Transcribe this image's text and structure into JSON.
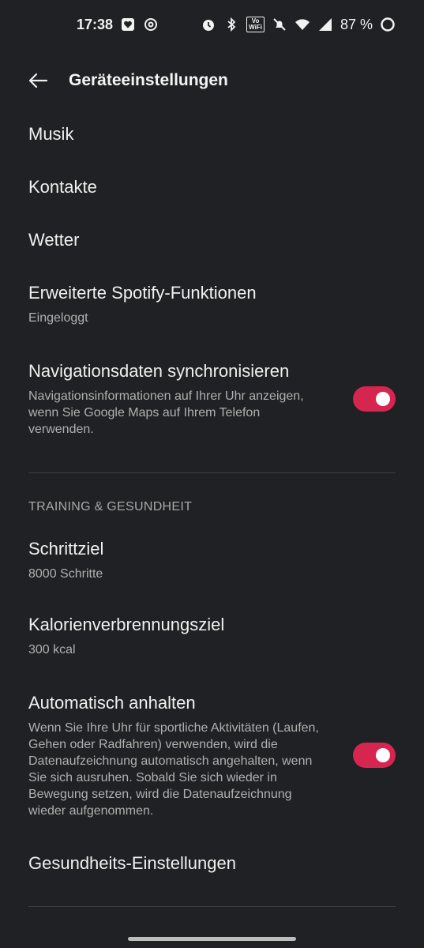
{
  "status_bar": {
    "time": "17:38",
    "battery": "87 %",
    "icons": [
      "heart-box-icon",
      "threads-icon",
      "alarm-icon",
      "bluetooth-icon",
      "vowifi-icon",
      "mute-icon",
      "wifi-icon",
      "signal-icon",
      "battery-ring-icon"
    ],
    "volte_line1": "Vo",
    "volte_line2": "WiFi"
  },
  "app_bar": {
    "title": "Geräteeinstellungen",
    "back_icon": "arrow-left-icon"
  },
  "settings": {
    "musik": {
      "title": "Musik"
    },
    "kontakte": {
      "title": "Kontakte"
    },
    "wetter": {
      "title": "Wetter"
    },
    "spotify": {
      "title": "Erweiterte Spotify-Funktionen",
      "subtitle": "Eingeloggt"
    },
    "navigation": {
      "title": "Navigationsdaten synchronisieren",
      "subtitle": "Navigationsinformationen auf Ihrer Uhr anzeigen, wenn Sie Google Maps auf Ihrem Telefon verwenden.",
      "enabled": true
    }
  },
  "section_training": {
    "header": "TRAINING & GESUNDHEIT",
    "schrittziel": {
      "title": "Schrittziel",
      "subtitle": "8000 Schritte"
    },
    "kalorien": {
      "title": "Kalorienverbrennungsziel",
      "subtitle": "300 kcal"
    },
    "auto_pause": {
      "title": "Automatisch anhalten",
      "subtitle": "Wenn Sie Ihre Uhr für sportliche Aktivitäten (Laufen, Gehen oder Radfahren) verwenden, wird die Datenaufzeichnung automatisch angehalten, wenn Sie sich ausruhen. Sobald Sie sich wieder in Bewegung setzen, wird die Datenaufzeichnung wieder aufgenommen.",
      "enabled": true
    },
    "gesundheit": {
      "title": "Gesundheits-Einstellungen"
    }
  },
  "colors": {
    "background": "#202124",
    "toggle_on": "#d6264f",
    "text_primary": "#f0f0f0",
    "text_secondary": "#b0b0b0"
  }
}
